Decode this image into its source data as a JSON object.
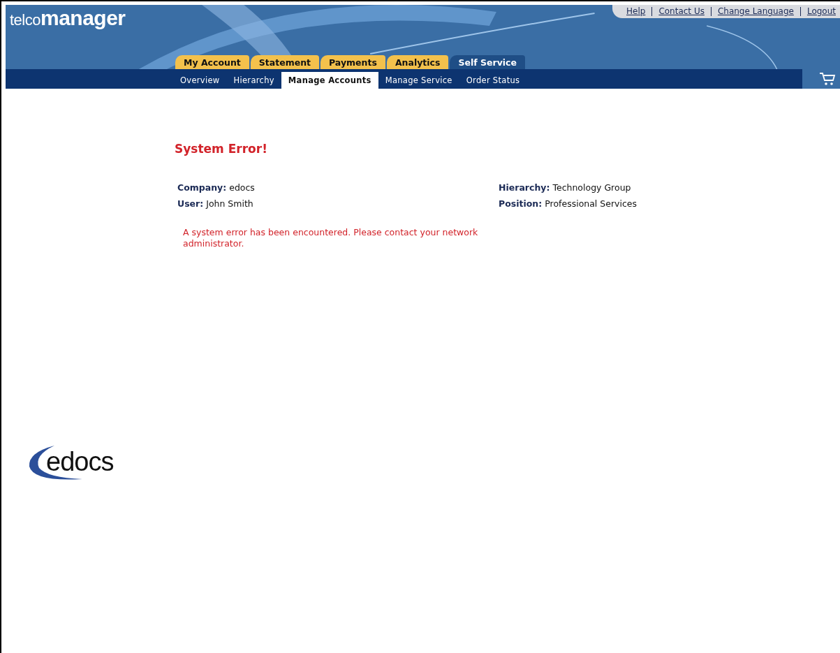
{
  "brand": {
    "logo": "telco**manager**"
  },
  "top_links": [
    "Help",
    "Contact Us",
    "Change Language",
    "Logout"
  ],
  "tabs": [
    {
      "label": "My Account",
      "selected": false
    },
    {
      "label": "Statement",
      "selected": false
    },
    {
      "label": "Payments",
      "selected": false
    },
    {
      "label": "Analytics",
      "selected": false
    },
    {
      "label": "Self Service",
      "selected": true
    }
  ],
  "subnav": [
    {
      "label": "Overview",
      "selected": false
    },
    {
      "label": "Hierarchy",
      "selected": false
    },
    {
      "label": "Manage Accounts",
      "selected": true
    },
    {
      "label": "Manage Service",
      "selected": false
    },
    {
      "label": "Order Status",
      "selected": false
    }
  ],
  "title": "System Error!",
  "info": [
    {
      "label": "Company:",
      "value": "edocs"
    },
    {
      "label": "Hierarchy:",
      "value": "Technology Group"
    },
    {
      "label": "User:",
      "value": "John Smith"
    },
    {
      "label": "Position:",
      "value": "Professional Services"
    }
  ],
  "message": "A system error has been encountered. Please contact your network administrator.",
  "footer_logo": "edocs"
}
